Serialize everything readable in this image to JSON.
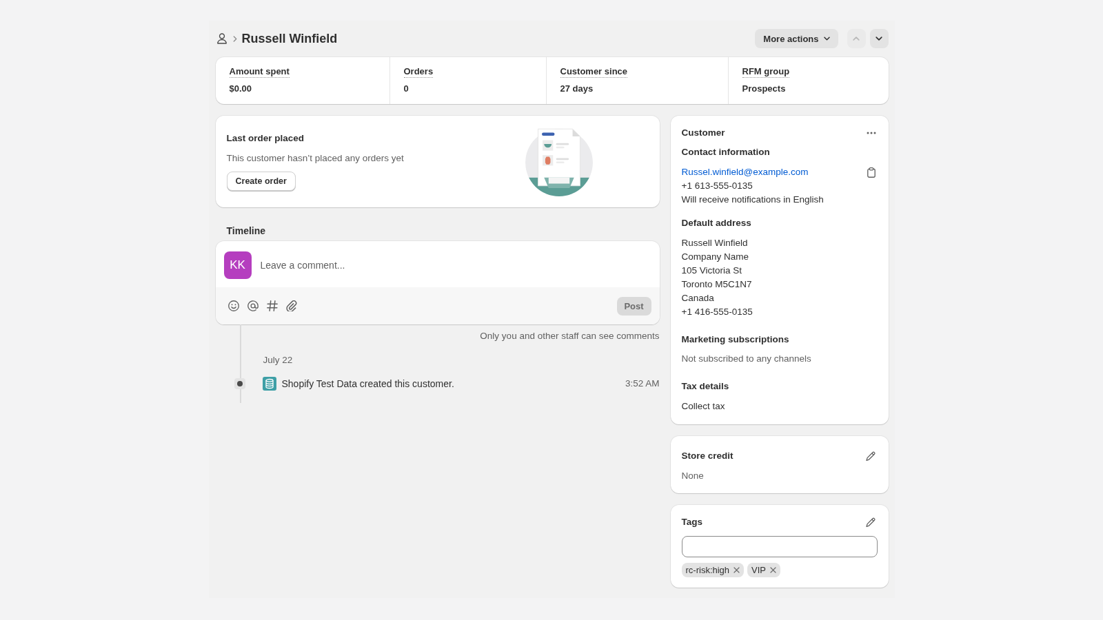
{
  "header": {
    "title": "Russell Winfield",
    "more_actions": "More actions",
    "previous": {
      "disabled": true
    },
    "next": {
      "disabled": false
    }
  },
  "stats": [
    {
      "label": "Amount spent",
      "value": "$0.00"
    },
    {
      "label": "Orders",
      "value": "0"
    },
    {
      "label": "Customer since",
      "value": "27 days"
    },
    {
      "label": "RFM group",
      "value": "Prospects"
    }
  ],
  "last_order": {
    "title": "Last order placed",
    "message": "This customer hasn’t placed any orders yet",
    "button": "Create order"
  },
  "timeline": {
    "title": "Timeline",
    "comment_box": {
      "avatar": "KK",
      "placeholder": "Leave a comment...",
      "post_button": {
        "label": "Post",
        "disabled": true
      }
    },
    "note": "Only you and other staff can see comments",
    "days": [
      {
        "date": "July 22",
        "events": [
          {
            "text": "Shopify Test Data created this customer.",
            "time": "3:52 AM"
          }
        ]
      }
    ]
  },
  "customer": {
    "title": "Customer",
    "contact": {
      "heading": "Contact information",
      "email": "Russel.winfield@example.com",
      "phone": "+1 613-555-0135",
      "language": "Will receive notifications in English"
    },
    "address": {
      "heading": "Default address",
      "lines": [
        "Russell Winfield",
        "Company Name",
        "105 Victoria St",
        "Toronto M5C1N7",
        "Canada",
        "+1 416-555-0135"
      ]
    },
    "marketing": {
      "heading": "Marketing subscriptions",
      "text": "Not subscribed to any channels"
    },
    "tax": {
      "heading": "Tax details",
      "text": "Collect tax"
    }
  },
  "store_credit": {
    "title": "Store credit",
    "value": "None"
  },
  "tags": {
    "title": "Tags",
    "items": [
      {
        "label": "rc-risk:high"
      },
      {
        "label": "VIP"
      }
    ]
  }
}
